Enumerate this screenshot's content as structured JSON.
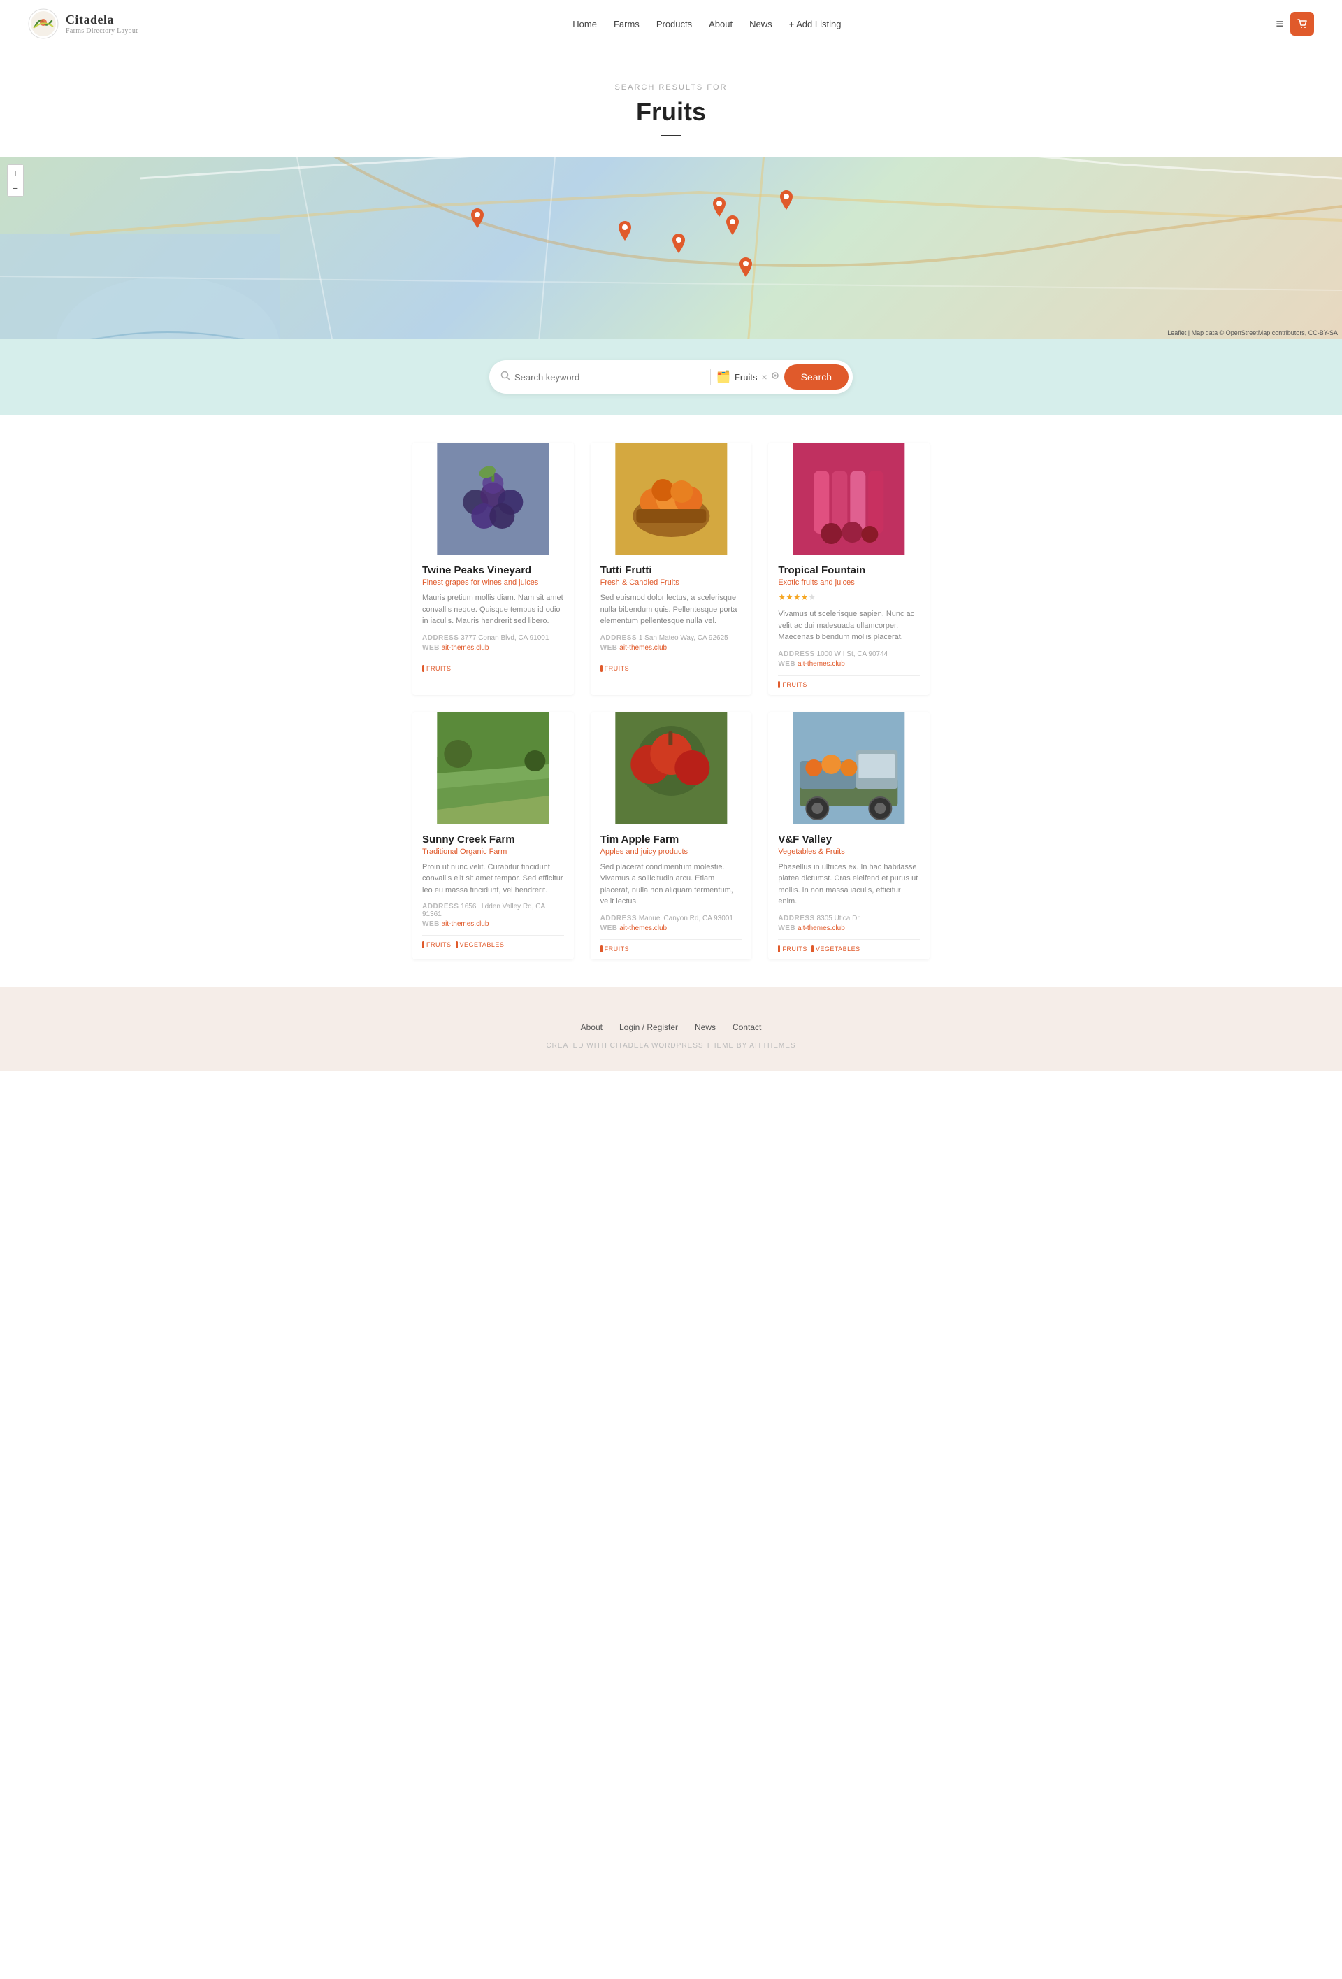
{
  "header": {
    "logo_title": "Citadela",
    "logo_subtitle": "Farms Directory Layout",
    "nav_items": [
      "Home",
      "Farms",
      "Products",
      "About",
      "News",
      "+ Add Listing"
    ],
    "cart_icon": "🛒"
  },
  "hero": {
    "label": "Search Results For",
    "title": "Fruits"
  },
  "search": {
    "keyword_placeholder": "Search keyword",
    "category_value": "Fruits",
    "search_btn": "Search"
  },
  "listings": [
    {
      "name": "Twine Peaks Vineyard",
      "category": "Finest grapes for wines and juices",
      "description": "Mauris pretium mollis diam. Nam sit amet convallis neque. Quisque tempus id odio in iaculis. Mauris hendrerit sed libero.",
      "address": "3777 Conan Blvd, CA 91001",
      "web": "ait-themes.club",
      "tags": [
        "FRUITS"
      ],
      "stars": 0,
      "image_bg": "#8b6f9c",
      "image_emoji": "🍇"
    },
    {
      "name": "Tutti Frutti",
      "category": "Fresh & Candied Fruits",
      "description": "Sed euismod dolor lectus, a scelerisque nulla bibendum quis. Pellentesque porta elementum pellentesque nulla vel.",
      "address": "1 San Mateo Way, CA 92625",
      "web": "ait-themes.club",
      "tags": [
        "FRUITS"
      ],
      "stars": 0,
      "image_bg": "#d4823a",
      "image_emoji": "🍊"
    },
    {
      "name": "Tropical Fountain",
      "category": "Exotic fruits and juices",
      "description": "Vivamus ut scelerisque sapien. Nunc ac velit ac dui malesuada ullamcorper. Maecenas bibendum mollis placerat.",
      "address": "1000 W I St, CA 90744",
      "web": "ait-themes.club",
      "tags": [
        "FRUITS"
      ],
      "stars": 4,
      "image_bg": "#c0306a",
      "image_emoji": "🧃"
    },
    {
      "name": "Sunny Creek Farm",
      "category": "Traditional Organic Farm",
      "description": "Proin ut nunc velit. Curabitur tincidunt convallis elit sit amet tempor. Sed efficitur leo eu massa tincidunt, vel hendrerit.",
      "address": "1656 Hidden Valley Rd, CA 91361",
      "web": "ait-themes.club",
      "tags": [
        "FRUITS",
        "VEGETABLES"
      ],
      "stars": 0,
      "image_bg": "#4a7a3a",
      "image_emoji": "🌾"
    },
    {
      "name": "Tim Apple Farm",
      "category": "Apples and juicy products",
      "description": "Sed placerat condimentum molestie. Vivamus a sollicitudin arcu. Etiam placerat, nulla non aliquam fermentum, velit lectus.",
      "address": "Manuel Canyon Rd, CA 93001",
      "web": "ait-themes.club",
      "tags": [
        "FRUITS"
      ],
      "stars": 0,
      "image_bg": "#c04a2a",
      "image_emoji": "🍎"
    },
    {
      "name": "V&F Valley",
      "category": "Vegetables & Fruits",
      "description": "Phasellus in ultrices ex. In hac habitasse platea dictumst. Cras eleifend et purus ut mollis. In non massa iaculis, efficitur enim.",
      "address": "8305 Utica Dr",
      "web": "ait-themes.club",
      "tags": [
        "FRUITS",
        "VEGETABLES"
      ],
      "stars": 0,
      "image_bg": "#b07030",
      "image_emoji": "🚛"
    }
  ],
  "map": {
    "zoom_in": "+",
    "zoom_out": "−",
    "attribution": "Leaflet | Map data © OpenStreetMap contributors, CC-BY-SA"
  },
  "footer": {
    "links": [
      "About",
      "Login / Register",
      "News",
      "Contact"
    ],
    "credit": "Created with Citadela WordPress Theme by AitThemes"
  }
}
